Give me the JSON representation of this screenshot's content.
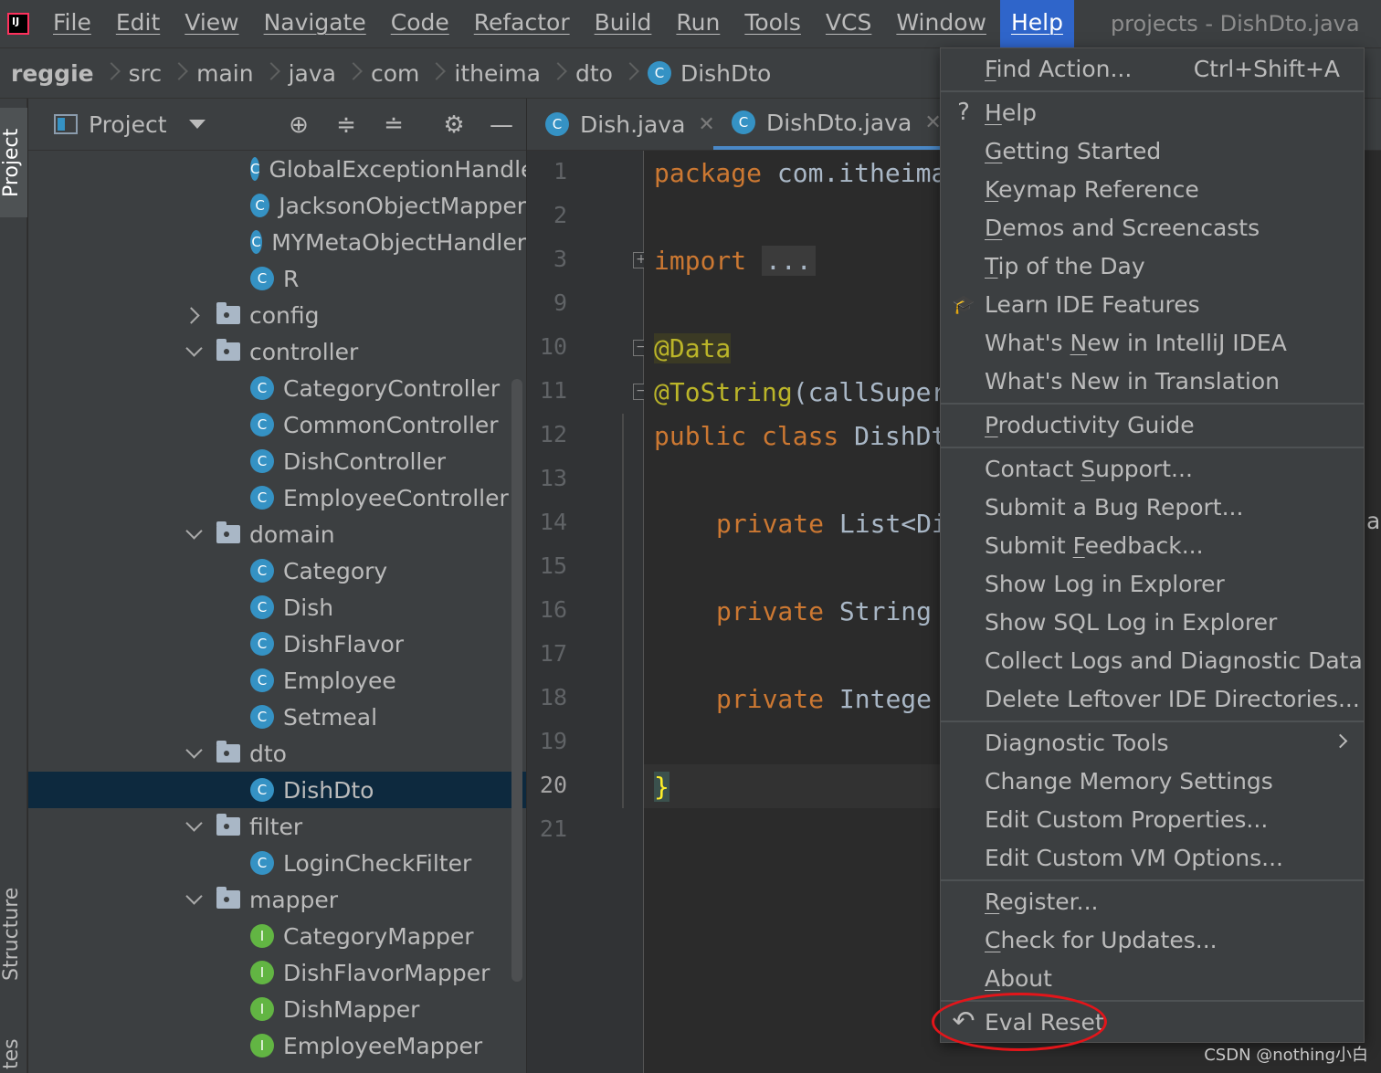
{
  "menubar": {
    "items": [
      "File",
      "Edit",
      "View",
      "Navigate",
      "Code",
      "Refactor",
      "Build",
      "Run",
      "Tools",
      "VCS",
      "Window",
      "Help"
    ],
    "active": "Help",
    "window_title": "projects - DishDto.java"
  },
  "breadcrumb": [
    "reggie",
    "src",
    "main",
    "java",
    "com",
    "itheima",
    "dto",
    "DishDto"
  ],
  "stripe": {
    "project": "Project",
    "structure": "Structure",
    "bottom": "tes"
  },
  "project_panel": {
    "title": "Project",
    "tree": [
      {
        "kind": "class",
        "label": "GlobalExceptionHandle"
      },
      {
        "kind": "class",
        "label": "JacksonObjectMapper"
      },
      {
        "kind": "class",
        "label": "MYMetaObjectHandler"
      },
      {
        "kind": "class",
        "label": "R"
      },
      {
        "kind": "folder",
        "label": "config",
        "state": "collapsed"
      },
      {
        "kind": "folder",
        "label": "controller",
        "state": "expanded"
      },
      {
        "kind": "class",
        "label": "CategoryController"
      },
      {
        "kind": "class",
        "label": "CommonController"
      },
      {
        "kind": "class",
        "label": "DishController"
      },
      {
        "kind": "class",
        "label": "EmployeeController"
      },
      {
        "kind": "folder",
        "label": "domain",
        "state": "expanded"
      },
      {
        "kind": "class",
        "label": "Category"
      },
      {
        "kind": "class",
        "label": "Dish"
      },
      {
        "kind": "class",
        "label": "DishFlavor"
      },
      {
        "kind": "class",
        "label": "Employee"
      },
      {
        "kind": "class",
        "label": "Setmeal"
      },
      {
        "kind": "folder",
        "label": "dto",
        "state": "expanded"
      },
      {
        "kind": "class",
        "label": "DishDto",
        "selected": true
      },
      {
        "kind": "folder",
        "label": "filter",
        "state": "expanded"
      },
      {
        "kind": "class",
        "label": "LoginCheckFilter"
      },
      {
        "kind": "folder",
        "label": "mapper",
        "state": "expanded"
      },
      {
        "kind": "interface",
        "label": "CategoryMapper"
      },
      {
        "kind": "interface",
        "label": "DishFlavorMapper"
      },
      {
        "kind": "interface",
        "label": "DishMapper"
      },
      {
        "kind": "interface",
        "label": "EmployeeMapper"
      }
    ]
  },
  "editor": {
    "tabs": [
      {
        "label": "Dish.java",
        "active": false
      },
      {
        "label": "DishDto.java",
        "active": true
      }
    ],
    "line_numbers": [
      "1",
      "2",
      "3",
      "9",
      "10",
      "11",
      "12",
      "13",
      "14",
      "15",
      "16",
      "17",
      "18",
      "19",
      "20",
      "21"
    ],
    "current_line": "20",
    "code": {
      "l1_kw": "package",
      "l1_rest": " com.itheima",
      "l3_kw": "import",
      "l3_fold": "...",
      "l10": "@Data",
      "l11_ann": "@ToString",
      "l11_rest": "(callSuper",
      "l12_kw": "public class",
      "l12_rest": " DishDt",
      "l14_kw": "private",
      "l14_rest": " List<Di",
      "l16_kw": "private",
      "l16_rest": " String",
      "l18_kw": "private",
      "l18_rest": " Intege",
      "l20": "}"
    }
  },
  "help_menu": {
    "items": [
      {
        "id": "find-action",
        "pre": "",
        "u": "F",
        "post": "ind Action...",
        "shortcut": "Ctrl+Shift+A"
      },
      {
        "id": "help",
        "pre": "",
        "u": "H",
        "post": "elp",
        "icon": "?"
      },
      {
        "id": "getting-started",
        "pre": "",
        "u": "G",
        "post": "etting Started"
      },
      {
        "id": "keymap-reference",
        "pre": "",
        "u": "K",
        "post": "eymap Reference"
      },
      {
        "id": "demos-screencasts",
        "pre": "",
        "u": "D",
        "post": "emos and Screencasts"
      },
      {
        "id": "tip-of-the-day",
        "pre": "",
        "u": "T",
        "post": "ip of the Day"
      },
      {
        "id": "learn-ide-features",
        "pre": "Learn IDE Features",
        "u": "",
        "post": ""
      },
      {
        "id": "whats-new-idea",
        "pre": "What's ",
        "u": "N",
        "post": "ew in IntelliJ IDEA"
      },
      {
        "id": "whats-new-translation",
        "pre": "What's New in Translation",
        "u": "",
        "post": ""
      },
      {
        "id": "productivity-guide",
        "pre": "",
        "u": "P",
        "post": "roductivity Guide"
      },
      {
        "id": "contact-support",
        "pre": "Contact ",
        "u": "S",
        "post": "upport..."
      },
      {
        "id": "submit-bug-report",
        "pre": "Submit a Bug Report...",
        "u": "",
        "post": ""
      },
      {
        "id": "submit-feedback",
        "pre": "Submit ",
        "u": "F",
        "post": "eedback..."
      },
      {
        "id": "show-log",
        "pre": "Show Log in Explorer",
        "u": "",
        "post": ""
      },
      {
        "id": "show-sql-log",
        "pre": "Show SQL Log in Explorer",
        "u": "",
        "post": ""
      },
      {
        "id": "collect-logs",
        "pre": "Collect Logs and Diagnostic Data",
        "u": "",
        "post": ""
      },
      {
        "id": "delete-leftover",
        "pre": "Delete Leftover IDE Directories...",
        "u": "",
        "post": ""
      },
      {
        "id": "diagnostic-tools",
        "pre": "Diagnostic Tools",
        "u": "",
        "post": "",
        "submenu": true
      },
      {
        "id": "change-memory",
        "pre": "Change Memory Settings",
        "u": "",
        "post": ""
      },
      {
        "id": "edit-custom-properties",
        "pre": "Edit Custom Properties...",
        "u": "",
        "post": ""
      },
      {
        "id": "edit-custom-vm",
        "pre": "Edit Custom VM Options...",
        "u": "",
        "post": ""
      },
      {
        "id": "register",
        "pre": "",
        "u": "R",
        "post": "egister..."
      },
      {
        "id": "check-updates",
        "pre": "",
        "u": "C",
        "post": "heck for Updates..."
      },
      {
        "id": "about",
        "pre": "",
        "u": "A",
        "post": "bout"
      },
      {
        "id": "eval-reset",
        "pre": "Eval Reset",
        "u": "",
        "post": ""
      }
    ]
  },
  "watermark": "CSDN @nothing小白",
  "right_fragment": "a",
  "colors": {
    "accent": "#2f65ca",
    "selection": "#0d293e",
    "highlight_circle": "#e3151a"
  }
}
